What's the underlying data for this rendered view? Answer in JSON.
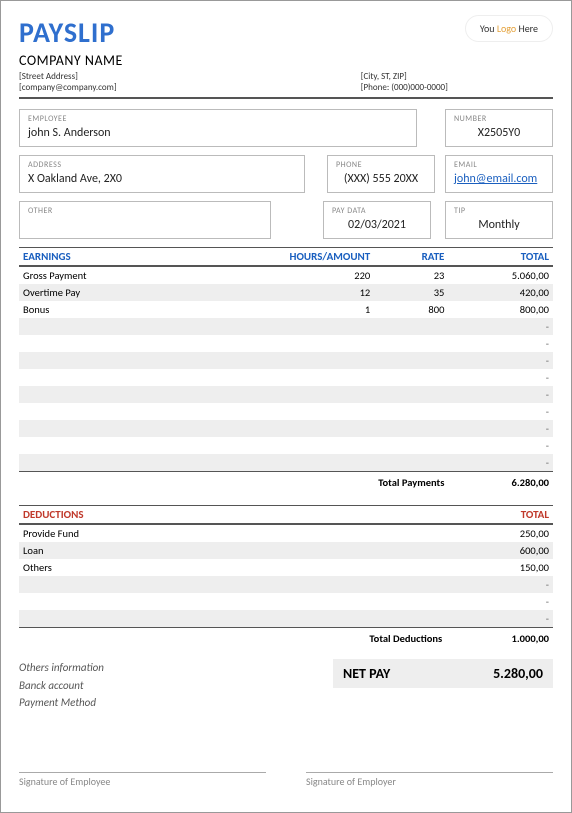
{
  "header": {
    "title": "PAYSLIP",
    "logo_prefix": "You ",
    "logo_word": "Logo",
    "logo_suffix": " Here",
    "company": "COMPANY NAME",
    "street": "[Street Address]",
    "email_tpl": "[company@company.com]",
    "city": "[City, ST, ZIP]",
    "phone_tpl": "[Phone: (000)000-0000]"
  },
  "fields": {
    "employee_label": "EMPLOYEE",
    "employee": "john S. Anderson",
    "number_label": "NUMBER",
    "number": "X2505Y0",
    "address_label": "ADDRESS",
    "address": "X Oakland Ave, 2X0",
    "phone_label": "PHONE",
    "phone": "(XXX) 555 20XX",
    "email_label": "EMAIL",
    "email": "john@email.com",
    "other_label": "OTHER",
    "other": "",
    "paydata_label": "PAY DATA",
    "paydata": "02/03/2021",
    "tip_label": "TIP",
    "tip": "Monthly"
  },
  "earnings": {
    "h1": "EARNINGS",
    "h2": "HOURS/AMOUNT",
    "h3": "RATE",
    "h4": "TOTAL",
    "rows": [
      {
        "name": "Gross Payment",
        "hours": "220",
        "rate": "23",
        "total": "5.060,00"
      },
      {
        "name": "Overtime Pay",
        "hours": "12",
        "rate": "35",
        "total": "420,00"
      },
      {
        "name": "Bonus",
        "hours": "1",
        "rate": "800",
        "total": "800,00"
      }
    ],
    "blank_count": 9,
    "total_label": "Total Payments",
    "total": "6.280,00"
  },
  "deductions": {
    "h1": "DEDUCTIONS",
    "h4": "TOTAL",
    "rows": [
      {
        "name": "Provide Fund",
        "total": "250,00"
      },
      {
        "name": "Loan",
        "total": "600,00"
      },
      {
        "name": "Others",
        "total": "150,00"
      }
    ],
    "blank_count": 3,
    "total_label": "Total Deductions",
    "total": "1.000,00"
  },
  "net": {
    "info1": "Others information",
    "info2": "Banck account",
    "info3": "Payment Method",
    "label": "NET PAY",
    "value": "5.280,00"
  },
  "sign": {
    "emp": "Signature of Employee",
    "empl": "Signature of Employer"
  },
  "dash": "-"
}
